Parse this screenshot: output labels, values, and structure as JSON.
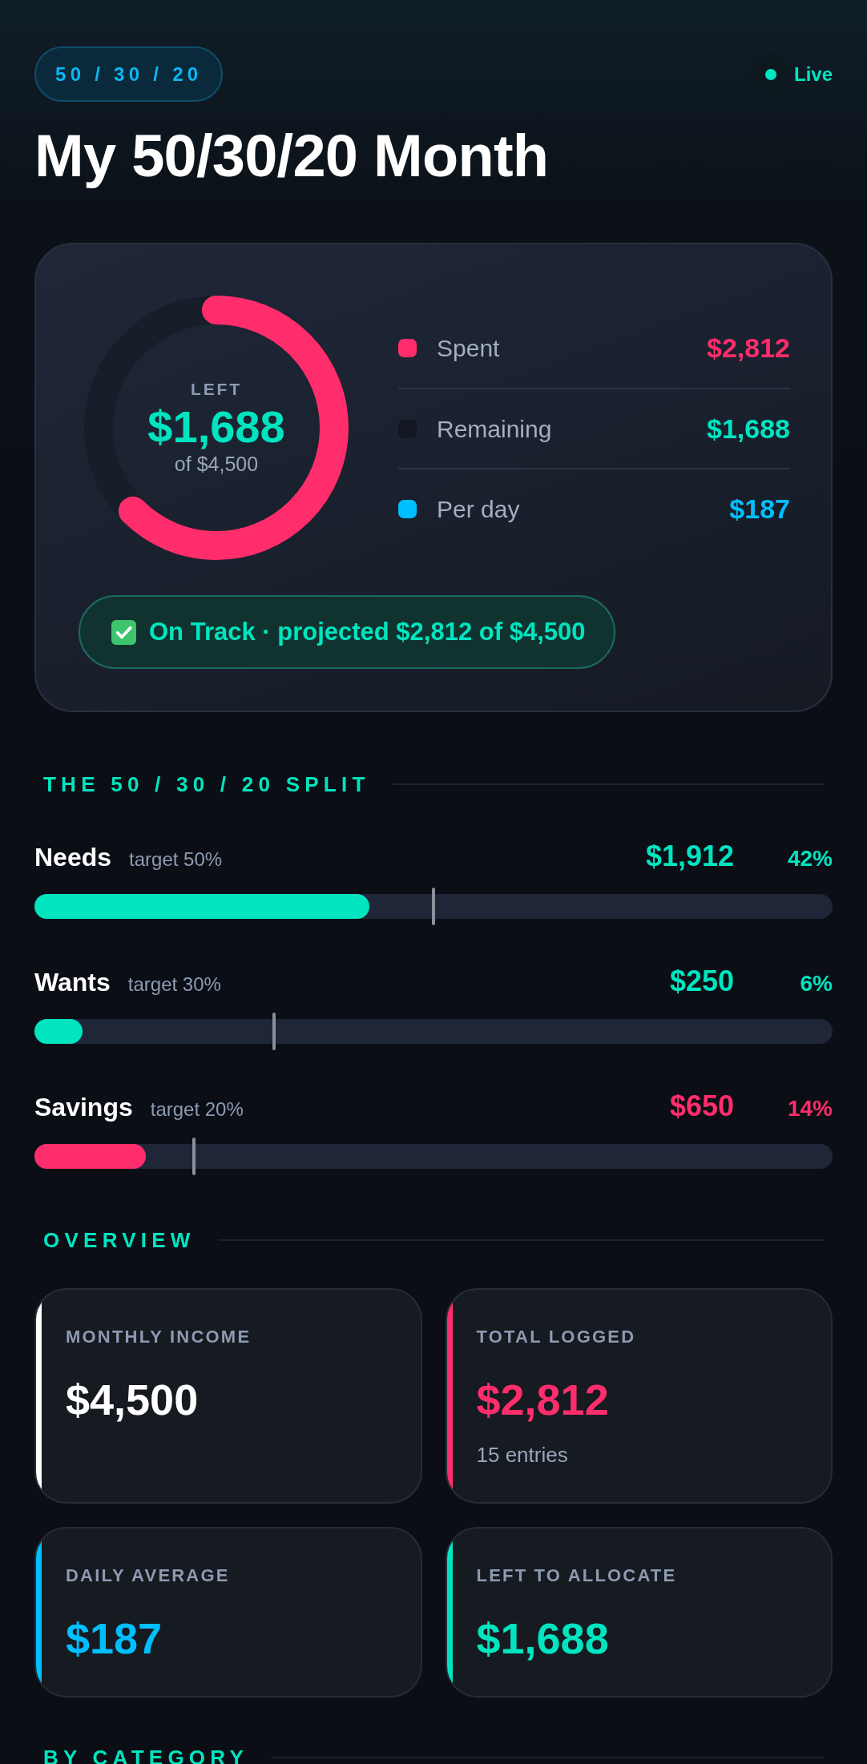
{
  "header": {
    "badge": "50 / 30 / 20",
    "live": {
      "label": "Live",
      "on": true
    },
    "title": "My 50/30/20 Month"
  },
  "summary": {
    "ring": {
      "label": "LEFT",
      "value": "$1,688",
      "caption": "of $4,500",
      "level": 0.625
    },
    "legend": [
      {
        "label": "Spent",
        "color": "#ff2d6b",
        "value": {
          "text": "$2,812",
          "color": "#ff2d6b"
        }
      },
      {
        "label": "Remaining",
        "color": "#121722",
        "value": {
          "text": "$1,688",
          "color": "#00e5c0"
        }
      },
      {
        "label": "Per day",
        "color": "#00bfff",
        "value": {
          "text": "$187",
          "color": "#00bfff"
        }
      }
    ],
    "status": {
      "on_track": true,
      "text": "On Track · projected $2,812 of $4,500"
    }
  },
  "split": {
    "heading": "THE 50 / 30 / 20 SPLIT",
    "items": [
      {
        "name": "Needs",
        "target": "target 50%",
        "amount": "$1,912",
        "percent": "42%",
        "level": 0.42,
        "marker": {
          "level": 0.5
        },
        "color": "#00e5c0"
      },
      {
        "name": "Wants",
        "target": "target 30%",
        "amount": "$250",
        "percent": "6%",
        "level": 0.06,
        "marker": {
          "level": 0.3
        },
        "color": "#00e5c0"
      },
      {
        "name": "Savings",
        "target": "target 20%",
        "amount": "$650",
        "percent": "14%",
        "level": 0.14,
        "marker": {
          "level": 0.2
        },
        "color": "#ff2d6b"
      }
    ]
  },
  "overview": {
    "heading": "OVERVIEW",
    "cards": [
      {
        "label": "MONTHLY INCOME",
        "value": "$4,500",
        "color": "#ffffff"
      },
      {
        "label": "TOTAL LOGGED",
        "value": "$2,812",
        "note": "15 entries",
        "color": "#ff2d6b"
      },
      {
        "label": "DAILY AVERAGE",
        "value": "$187",
        "color": "#00bfff"
      },
      {
        "label": "LEFT TO ALLOCATE",
        "value": "$1,688",
        "color": "#00e5c0"
      }
    ]
  },
  "by_category": {
    "heading": "BY CATEGORY"
  }
}
